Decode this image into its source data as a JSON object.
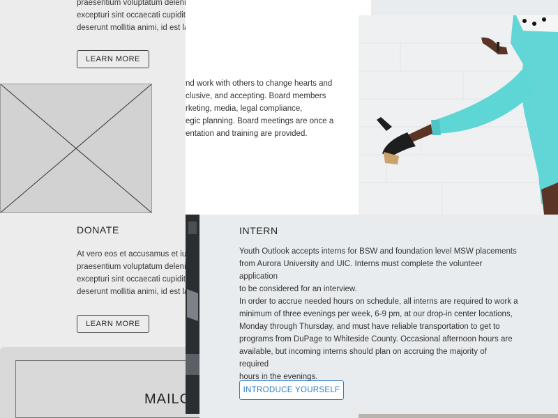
{
  "wireframe": {
    "top_text": [
      "praesentium voluptatum deleniti a",
      "excepturi sint occaecati cupiditate n",
      "deserunt mollitia animi, id est labo"
    ],
    "learn_more_1": "LEARN MORE",
    "donate_title": "DONATE",
    "donate_text": [
      "At vero eos et accusamus et iusto o",
      "praesentium voluptatum deleniti a",
      "excepturi sint occaecati cupiditate n",
      "deserunt mollitia animi, id est labo"
    ],
    "learn_more_2": "LEARN MORE",
    "mail_title": "MAILC"
  },
  "board": {
    "lines": [
      "nd work with others to change hearts and",
      "clusive, and accepting. Board members",
      "rketing, media, legal compliance,",
      "egic planning.  Board meetings are once a",
      "entation and training are provided."
    ]
  },
  "intern": {
    "title": "INTERN",
    "para1": [
      "Youth Outlook accepts interns for BSW and foundation level MSW placements",
      "from Aurora University and UIC. Interns must complete the volunteer application",
      "to be considered for an interview."
    ],
    "para2": [
      "In order to accrue needed hours on schedule, all interns are required to work a",
      "minimum of three evenings per week, 6-9 pm, at our drop-in center locations,",
      "Monday through Thursday, and must have reliable transportation to get to",
      "programs from DuPage to Whiteside County.  Occasional afternoon hours are",
      "available, but incoming interns should plan on accruing the majority of required",
      "hours in the evenings."
    ],
    "button": "INTRODUCE YOURSELF"
  },
  "colors": {
    "accent": "#2d7fc2",
    "pant": "#5fd6d6",
    "wire_bg": "#ececec"
  },
  "icons": {
    "image_placeholder": "crossed-box"
  }
}
